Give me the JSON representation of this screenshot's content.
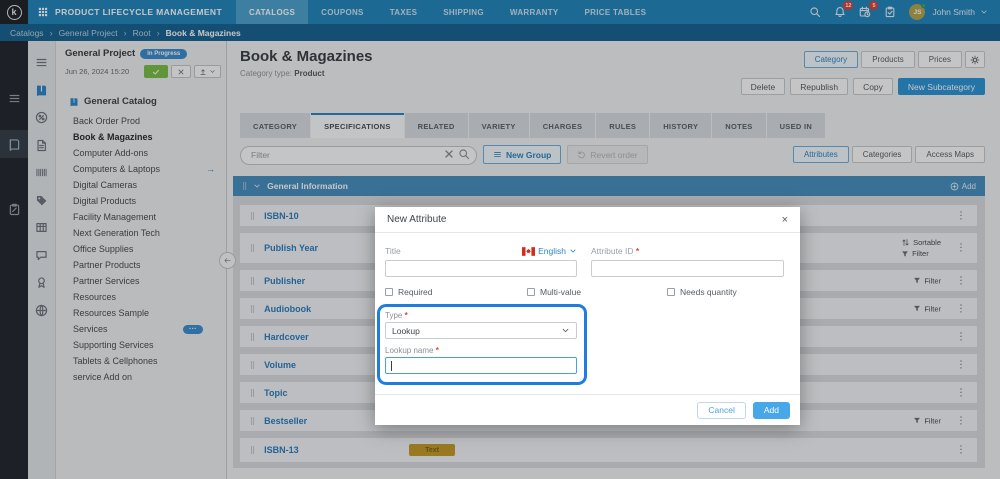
{
  "navbar": {
    "logo_letter": "k",
    "brand": "PRODUCT LIFECYCLE MANAGEMENT",
    "items": [
      {
        "label": "CATALOGS",
        "active": true
      },
      {
        "label": "COUPONS"
      },
      {
        "label": "TAXES"
      },
      {
        "label": "SHIPPING"
      },
      {
        "label": "WARRANTY"
      },
      {
        "label": "PRICE TABLES"
      }
    ],
    "notifications_count": "12",
    "tasks_count": "5",
    "user": {
      "name": "John Smith",
      "initials": "JS"
    }
  },
  "breadcrumb": {
    "separator": "›",
    "items": [
      "Catalogs",
      "General Project",
      "Root",
      "Book & Magazines"
    ]
  },
  "rails": {
    "dark_icons": [
      "menu",
      "book",
      "clipboard"
    ],
    "light_icons": [
      "menu",
      "book",
      "percent",
      "document",
      "barcode",
      "tag",
      "table",
      "chat",
      "award",
      "globe"
    ]
  },
  "left_panel": {
    "project_name": "General Project",
    "project_status": "In Progress",
    "project_date": "Jun 26, 2024 15:20",
    "catalog_name": "General Catalog",
    "tree": [
      {
        "label": "Back Order Prod"
      },
      {
        "label": "Book & Magazines",
        "selected": true
      },
      {
        "label": "Computer Add-ons"
      },
      {
        "label": "Computers & Laptops",
        "arrow": "→"
      },
      {
        "label": "Digital Cameras"
      },
      {
        "label": "Digital Products"
      },
      {
        "label": "Facility Management"
      },
      {
        "label": "Next Generation Tech"
      },
      {
        "label": "Office Supplies"
      },
      {
        "label": "Partner Products"
      },
      {
        "label": "Partner Services"
      },
      {
        "label": "Resources"
      },
      {
        "label": "Resources Sample"
      },
      {
        "label": "Services",
        "badge": "•••"
      },
      {
        "label": "Supporting Services"
      },
      {
        "label": "Tablets & Cellphones"
      },
      {
        "label": "service Add on"
      }
    ]
  },
  "main": {
    "title": "Book & Magazines",
    "subtitle_label": "Category type:",
    "subtitle_value": "Product",
    "view_switch": [
      {
        "label": "Category",
        "active": true
      },
      {
        "label": "Products"
      },
      {
        "label": "Prices"
      }
    ],
    "actions": [
      {
        "label": "Delete"
      },
      {
        "label": "Republish"
      },
      {
        "label": "Copy"
      },
      {
        "label": "New Subcategory",
        "primary": true
      }
    ],
    "tabs": [
      {
        "label": "CATEGORY"
      },
      {
        "label": "SPECIFICATIONS",
        "active": true
      },
      {
        "label": "RELATED"
      },
      {
        "label": "VARIETY"
      },
      {
        "label": "CHARGES"
      },
      {
        "label": "RULES"
      },
      {
        "label": "HISTORY"
      },
      {
        "label": "NOTES"
      },
      {
        "label": "USED IN"
      }
    ],
    "toolbar": {
      "filter_placeholder": "Filter",
      "new_group_label": "New Group",
      "revert_label": "Revert order",
      "right_switch": [
        {
          "label": "Attributes",
          "active": true
        },
        {
          "label": "Categories"
        },
        {
          "label": "Access Maps"
        }
      ]
    },
    "section": {
      "title": "General Information",
      "add_label": "Add"
    },
    "rows": [
      {
        "label": "ISBN-10"
      },
      {
        "label": "Publish Year",
        "tall": true,
        "tags": [
          {
            "type": "sortable",
            "label": "Sortable"
          },
          {
            "type": "filter",
            "label": "Filter"
          }
        ]
      },
      {
        "label": "Publisher",
        "tags": [
          {
            "type": "filter",
            "label": "Filter"
          }
        ]
      },
      {
        "label": "Audiobook",
        "tags": [
          {
            "type": "filter",
            "label": "Filter"
          }
        ]
      },
      {
        "label": "Hardcover"
      },
      {
        "label": "Volume"
      },
      {
        "label": "Topic"
      },
      {
        "label": "Bestseller",
        "tags": [
          {
            "type": "filter",
            "label": "Filter"
          }
        ]
      },
      {
        "label": "ISBN-13",
        "last": true,
        "badge": "Text"
      }
    ]
  },
  "modal": {
    "title": "New Attribute",
    "title_field_label": "Title",
    "language": "English",
    "attribute_id_label": "Attribute ID",
    "required_mark": "*",
    "checkboxes": [
      "Required",
      "Multi-value",
      "Needs quantity"
    ],
    "type_label": "Type",
    "type_value": "Lookup",
    "lookup_label": "Lookup name",
    "cancel_label": "Cancel",
    "add_label": "Add"
  },
  "colors": {
    "navbar": "#2487bd",
    "accent": "#2f86c8",
    "primary_button": "#2f95d8",
    "section_header": "#4a90c0",
    "badge_gold": "#c59d2c",
    "success_green": "#7cbf4a",
    "alert_red": "#e0443a",
    "status_badge": "#3d8ed0",
    "highlight_annotation": "#1f7de0"
  }
}
